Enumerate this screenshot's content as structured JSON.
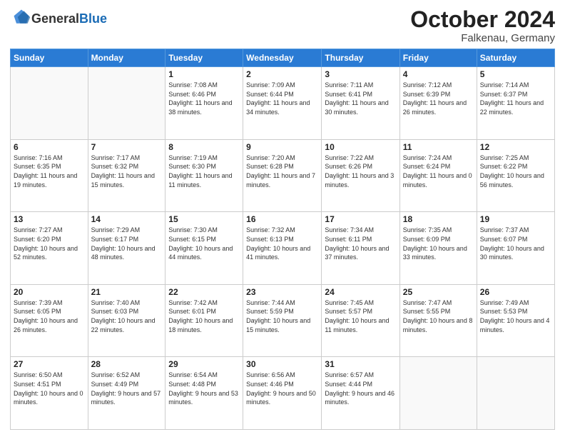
{
  "logo": {
    "general": "General",
    "blue": "Blue"
  },
  "header": {
    "month": "October 2024",
    "location": "Falkenau, Germany"
  },
  "weekdays": [
    "Sunday",
    "Monday",
    "Tuesday",
    "Wednesday",
    "Thursday",
    "Friday",
    "Saturday"
  ],
  "weeks": [
    [
      {
        "day": "",
        "sunrise": "",
        "sunset": "",
        "daylight": ""
      },
      {
        "day": "",
        "sunrise": "",
        "sunset": "",
        "daylight": ""
      },
      {
        "day": "1",
        "sunrise": "Sunrise: 7:08 AM",
        "sunset": "Sunset: 6:46 PM",
        "daylight": "Daylight: 11 hours and 38 minutes."
      },
      {
        "day": "2",
        "sunrise": "Sunrise: 7:09 AM",
        "sunset": "Sunset: 6:44 PM",
        "daylight": "Daylight: 11 hours and 34 minutes."
      },
      {
        "day": "3",
        "sunrise": "Sunrise: 7:11 AM",
        "sunset": "Sunset: 6:41 PM",
        "daylight": "Daylight: 11 hours and 30 minutes."
      },
      {
        "day": "4",
        "sunrise": "Sunrise: 7:12 AM",
        "sunset": "Sunset: 6:39 PM",
        "daylight": "Daylight: 11 hours and 26 minutes."
      },
      {
        "day": "5",
        "sunrise": "Sunrise: 7:14 AM",
        "sunset": "Sunset: 6:37 PM",
        "daylight": "Daylight: 11 hours and 22 minutes."
      }
    ],
    [
      {
        "day": "6",
        "sunrise": "Sunrise: 7:16 AM",
        "sunset": "Sunset: 6:35 PM",
        "daylight": "Daylight: 11 hours and 19 minutes."
      },
      {
        "day": "7",
        "sunrise": "Sunrise: 7:17 AM",
        "sunset": "Sunset: 6:32 PM",
        "daylight": "Daylight: 11 hours and 15 minutes."
      },
      {
        "day": "8",
        "sunrise": "Sunrise: 7:19 AM",
        "sunset": "Sunset: 6:30 PM",
        "daylight": "Daylight: 11 hours and 11 minutes."
      },
      {
        "day": "9",
        "sunrise": "Sunrise: 7:20 AM",
        "sunset": "Sunset: 6:28 PM",
        "daylight": "Daylight: 11 hours and 7 minutes."
      },
      {
        "day": "10",
        "sunrise": "Sunrise: 7:22 AM",
        "sunset": "Sunset: 6:26 PM",
        "daylight": "Daylight: 11 hours and 3 minutes."
      },
      {
        "day": "11",
        "sunrise": "Sunrise: 7:24 AM",
        "sunset": "Sunset: 6:24 PM",
        "daylight": "Daylight: 11 hours and 0 minutes."
      },
      {
        "day": "12",
        "sunrise": "Sunrise: 7:25 AM",
        "sunset": "Sunset: 6:22 PM",
        "daylight": "Daylight: 10 hours and 56 minutes."
      }
    ],
    [
      {
        "day": "13",
        "sunrise": "Sunrise: 7:27 AM",
        "sunset": "Sunset: 6:20 PM",
        "daylight": "Daylight: 10 hours and 52 minutes."
      },
      {
        "day": "14",
        "sunrise": "Sunrise: 7:29 AM",
        "sunset": "Sunset: 6:17 PM",
        "daylight": "Daylight: 10 hours and 48 minutes."
      },
      {
        "day": "15",
        "sunrise": "Sunrise: 7:30 AM",
        "sunset": "Sunset: 6:15 PM",
        "daylight": "Daylight: 10 hours and 44 minutes."
      },
      {
        "day": "16",
        "sunrise": "Sunrise: 7:32 AM",
        "sunset": "Sunset: 6:13 PM",
        "daylight": "Daylight: 10 hours and 41 minutes."
      },
      {
        "day": "17",
        "sunrise": "Sunrise: 7:34 AM",
        "sunset": "Sunset: 6:11 PM",
        "daylight": "Daylight: 10 hours and 37 minutes."
      },
      {
        "day": "18",
        "sunrise": "Sunrise: 7:35 AM",
        "sunset": "Sunset: 6:09 PM",
        "daylight": "Daylight: 10 hours and 33 minutes."
      },
      {
        "day": "19",
        "sunrise": "Sunrise: 7:37 AM",
        "sunset": "Sunset: 6:07 PM",
        "daylight": "Daylight: 10 hours and 30 minutes."
      }
    ],
    [
      {
        "day": "20",
        "sunrise": "Sunrise: 7:39 AM",
        "sunset": "Sunset: 6:05 PM",
        "daylight": "Daylight: 10 hours and 26 minutes."
      },
      {
        "day": "21",
        "sunrise": "Sunrise: 7:40 AM",
        "sunset": "Sunset: 6:03 PM",
        "daylight": "Daylight: 10 hours and 22 minutes."
      },
      {
        "day": "22",
        "sunrise": "Sunrise: 7:42 AM",
        "sunset": "Sunset: 6:01 PM",
        "daylight": "Daylight: 10 hours and 18 minutes."
      },
      {
        "day": "23",
        "sunrise": "Sunrise: 7:44 AM",
        "sunset": "Sunset: 5:59 PM",
        "daylight": "Daylight: 10 hours and 15 minutes."
      },
      {
        "day": "24",
        "sunrise": "Sunrise: 7:45 AM",
        "sunset": "Sunset: 5:57 PM",
        "daylight": "Daylight: 10 hours and 11 minutes."
      },
      {
        "day": "25",
        "sunrise": "Sunrise: 7:47 AM",
        "sunset": "Sunset: 5:55 PM",
        "daylight": "Daylight: 10 hours and 8 minutes."
      },
      {
        "day": "26",
        "sunrise": "Sunrise: 7:49 AM",
        "sunset": "Sunset: 5:53 PM",
        "daylight": "Daylight: 10 hours and 4 minutes."
      }
    ],
    [
      {
        "day": "27",
        "sunrise": "Sunrise: 6:50 AM",
        "sunset": "Sunset: 4:51 PM",
        "daylight": "Daylight: 10 hours and 0 minutes."
      },
      {
        "day": "28",
        "sunrise": "Sunrise: 6:52 AM",
        "sunset": "Sunset: 4:49 PM",
        "daylight": "Daylight: 9 hours and 57 minutes."
      },
      {
        "day": "29",
        "sunrise": "Sunrise: 6:54 AM",
        "sunset": "Sunset: 4:48 PM",
        "daylight": "Daylight: 9 hours and 53 minutes."
      },
      {
        "day": "30",
        "sunrise": "Sunrise: 6:56 AM",
        "sunset": "Sunset: 4:46 PM",
        "daylight": "Daylight: 9 hours and 50 minutes."
      },
      {
        "day": "31",
        "sunrise": "Sunrise: 6:57 AM",
        "sunset": "Sunset: 4:44 PM",
        "daylight": "Daylight: 9 hours and 46 minutes."
      },
      {
        "day": "",
        "sunrise": "",
        "sunset": "",
        "daylight": ""
      },
      {
        "day": "",
        "sunrise": "",
        "sunset": "",
        "daylight": ""
      }
    ]
  ]
}
